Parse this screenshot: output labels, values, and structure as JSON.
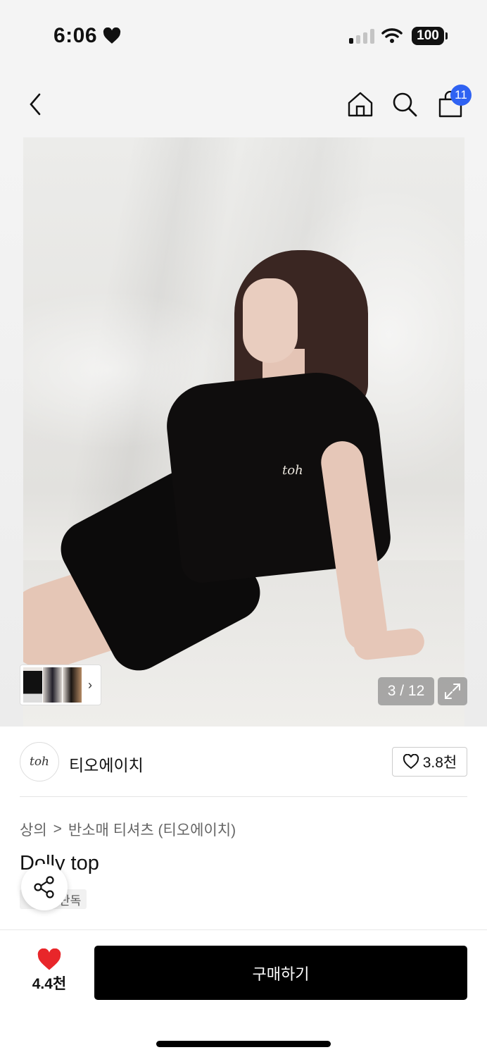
{
  "status_bar": {
    "time": "6:06",
    "battery": "100"
  },
  "nav": {
    "cart_badge": "11"
  },
  "gallery": {
    "counter": "3 / 12",
    "embroidery_text": "toh"
  },
  "brand": {
    "logo_text": "toh",
    "name": "티오에이치",
    "likes": "3.8천"
  },
  "breadcrumb": {
    "category": "상의",
    "separator": ">",
    "subcategory": "반소매 티셔츠 (티오에이치)"
  },
  "product": {
    "name": "Dolly top",
    "tag": "단독"
  },
  "bottom_bar": {
    "likes": "4.4천",
    "buy_label": "구매하기"
  },
  "colors": {
    "accent_badge": "#2f62f2",
    "heart": "#e8262a",
    "buy_button": "#000000"
  },
  "icons": [
    "heart-icon",
    "wifi-icon",
    "back-icon",
    "home-icon",
    "search-icon",
    "shopping-bag-icon",
    "chevron-right-icon",
    "expand-icon",
    "heart-outline-icon",
    "share-icon"
  ]
}
